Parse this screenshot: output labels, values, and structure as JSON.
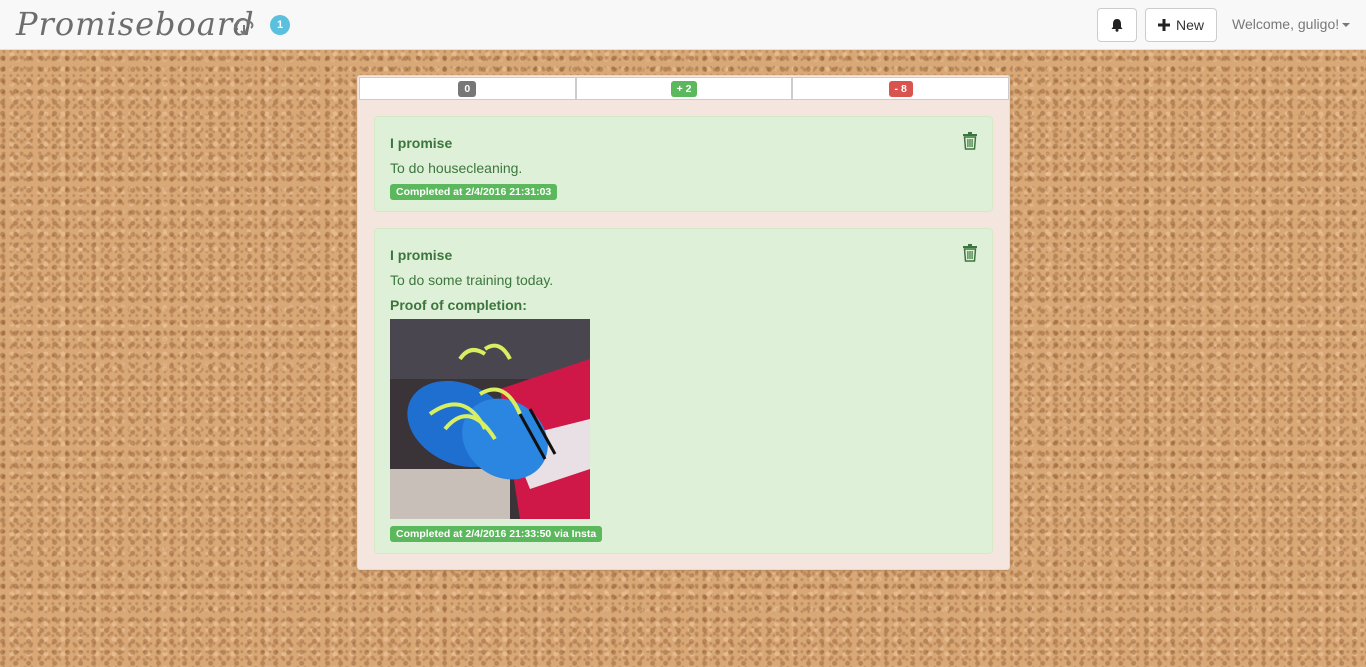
{
  "navbar": {
    "brand": "Promiseboard",
    "notification_count": "1",
    "bell_icon": "bell-icon",
    "new_label": "New",
    "welcome": "Welcome, guligo!"
  },
  "stats": [
    {
      "value": "0",
      "color": "#777777"
    },
    {
      "value": "+ 2",
      "color": "#5cb85c"
    },
    {
      "value": "- 8",
      "color": "#d9534f"
    }
  ],
  "promises": [
    {
      "title": "I promise",
      "text": "To do housecleaning.",
      "status": "Completed at 2/4/2016 21:31:03"
    },
    {
      "title": "I promise",
      "text": "To do some training today.",
      "proof_label": "Proof of completion:",
      "status": "Completed at 2/4/2016 21:33:50 via Insta"
    }
  ],
  "colors": {
    "card_bg": "#dff0d8",
    "card_text": "#3c763d",
    "badge_info": "#5bc0de"
  }
}
